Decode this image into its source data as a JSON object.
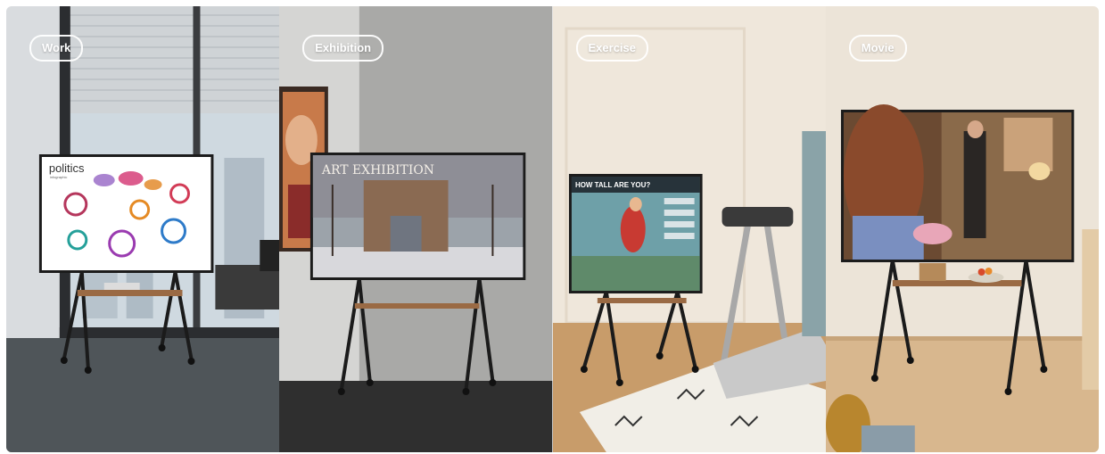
{
  "panels": [
    {
      "label": "Work",
      "screen_brand": "politics",
      "screen_subtitle": "infographic"
    },
    {
      "label": "Exhibition",
      "screen_title": "ART EXHIBITION"
    },
    {
      "label": "Exercise",
      "screen_title": "HOW TALL ARE YOU?"
    },
    {
      "label": "Movie"
    }
  ],
  "colors": {
    "pill_border": "#ffffff",
    "stand_black": "#1b1b1b",
    "shelf_wood": "#9a6a44"
  }
}
